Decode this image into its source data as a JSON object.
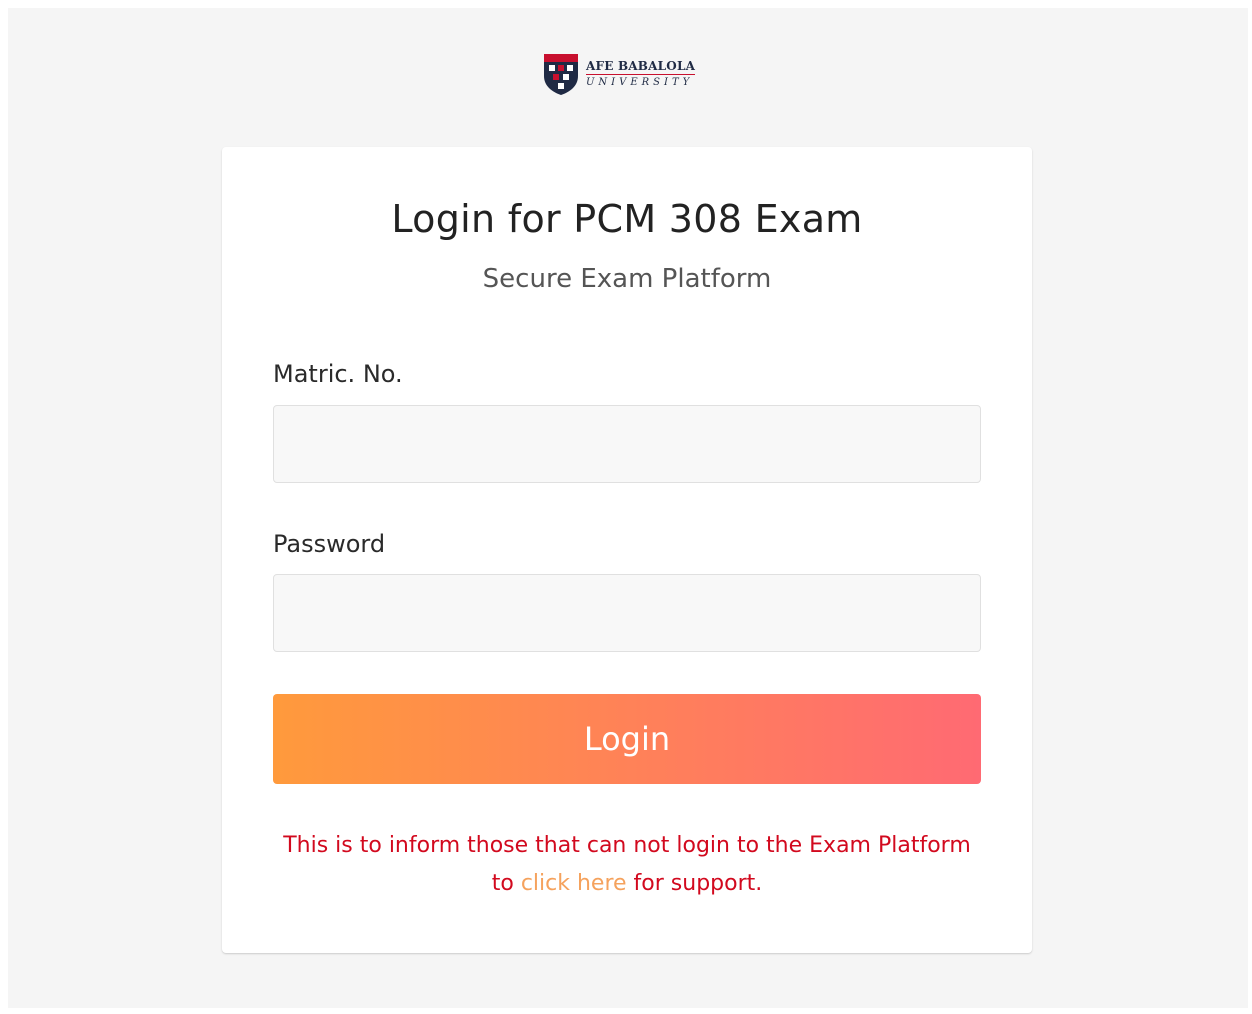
{
  "brand": {
    "name": "AFE BABALOLA",
    "subtitle": "UNIVERSITY",
    "colors": {
      "navy": "#1f2a44",
      "red": "#c8102e"
    }
  },
  "login": {
    "title": "Login for PCM 308 Exam",
    "subtitle": "Secure Exam Platform",
    "fields": {
      "matric": {
        "label": "Matric. No.",
        "value": "",
        "placeholder": ""
      },
      "password": {
        "label": "Password",
        "value": "",
        "placeholder": ""
      }
    },
    "button_label": "Login",
    "notice": {
      "line1": "This is to inform those that can not login to the Exam Platform",
      "prefix": "to ",
      "link_text": "click here",
      "suffix": " for support."
    }
  },
  "colors": {
    "button_gradient_start": "#ff9a3c",
    "button_gradient_end": "#ff6a73",
    "notice_text": "#d2091e",
    "notice_link": "#f5a25d"
  }
}
